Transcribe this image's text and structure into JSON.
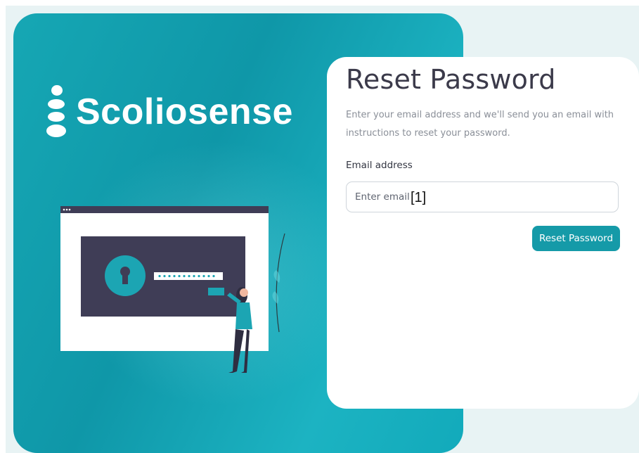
{
  "brand": {
    "name": "Scoliosense"
  },
  "form": {
    "title": "Reset Password",
    "subtitle": "Enter your email address and we'll send you an email with instructions to reset your password.",
    "email_label": "Email address",
    "email_placeholder": "Enter email",
    "email_value": "",
    "field_marker": "[1]",
    "submit_label": "Reset Password"
  },
  "colors": {
    "hero_teal": "#16a7b4",
    "button_teal": "#159aa8",
    "illustration_dark": "#3f3d56",
    "page_bg": "#e8f3f4"
  },
  "icons": [
    "logo-mark-icon",
    "keyhole-lock-icon",
    "masked-password-icon"
  ]
}
